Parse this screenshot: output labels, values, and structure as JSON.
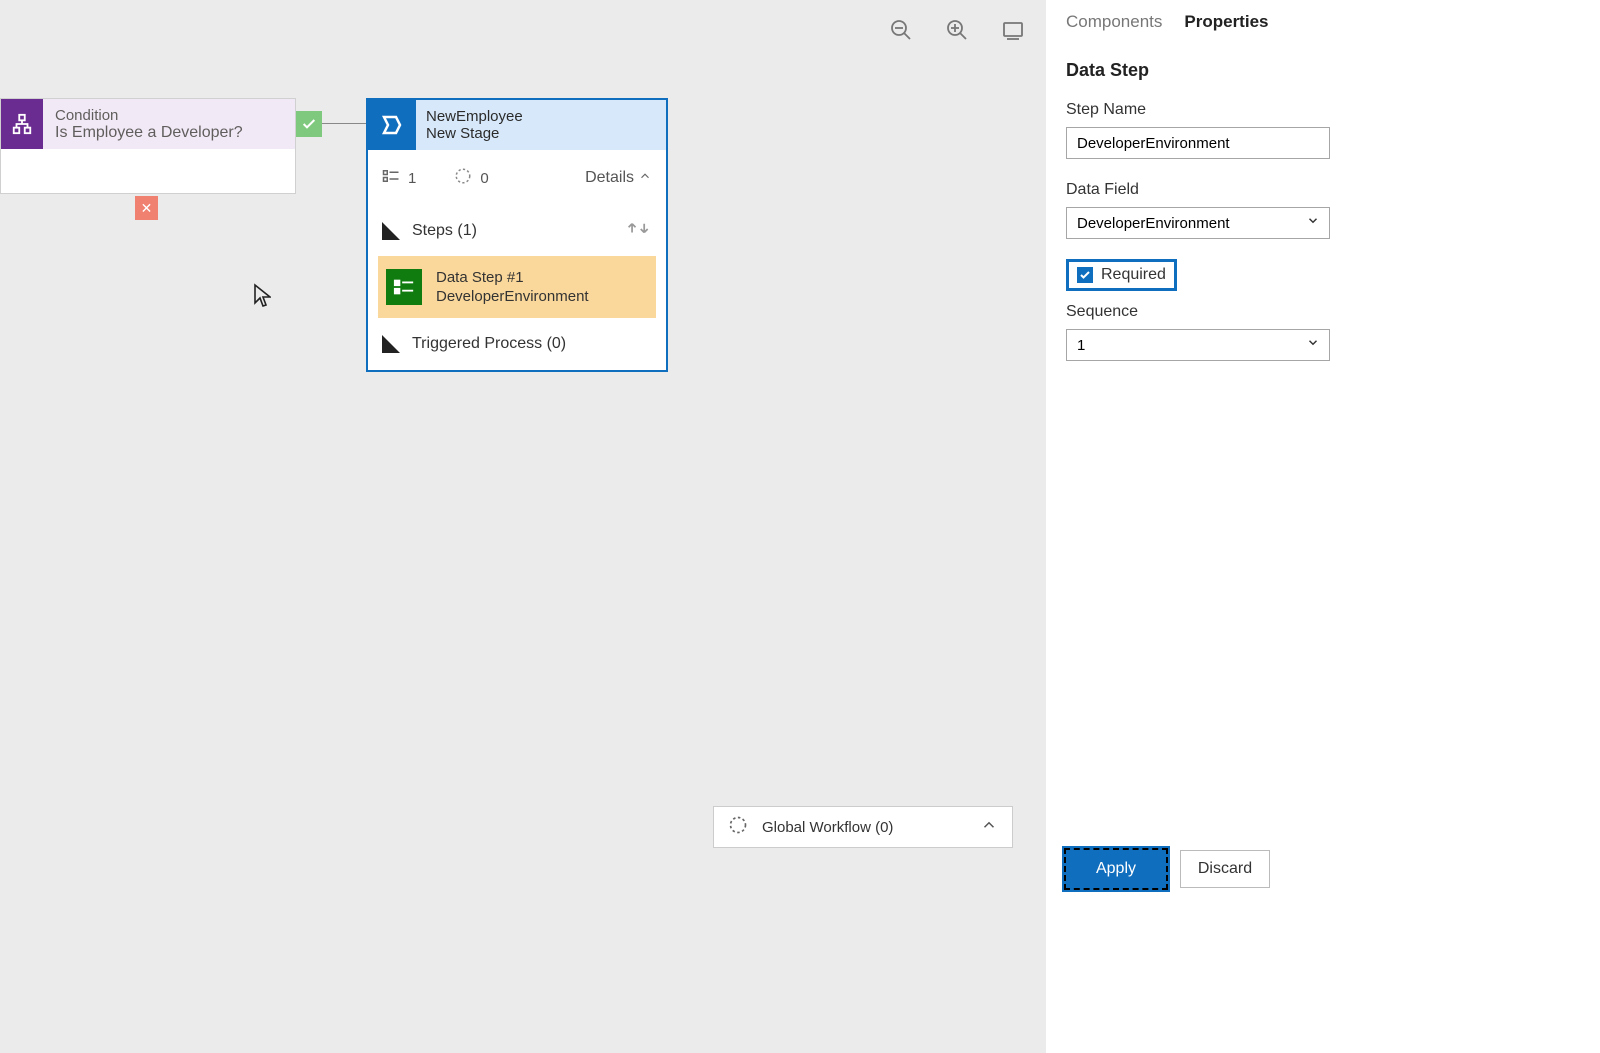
{
  "canvas": {
    "condition": {
      "type": "Condition",
      "name": "Is Employee a Developer?"
    },
    "branch_no": "✕",
    "stage": {
      "entity": "NewEmployee",
      "label": "New Stage",
      "fields_count": "1",
      "workflows_count": "0",
      "details_label": "Details",
      "steps_label": "Steps (1)",
      "data_step_title": "Data Step #1",
      "data_step_field": "DeveloperEnvironment",
      "trigger_label": "Triggered Process (0)"
    }
  },
  "global_workflow": {
    "label": "Global Workflow (0)"
  },
  "panel": {
    "tabs": {
      "components": "Components",
      "properties": "Properties"
    },
    "section": "Data Step",
    "step_name_label": "Step Name",
    "step_name_value": "DeveloperEnvironment",
    "data_field_label": "Data Field",
    "data_field_value": "DeveloperEnvironment",
    "required_label": "Required",
    "sequence_label": "Sequence",
    "sequence_value": "1",
    "apply": "Apply",
    "discard": "Discard"
  }
}
